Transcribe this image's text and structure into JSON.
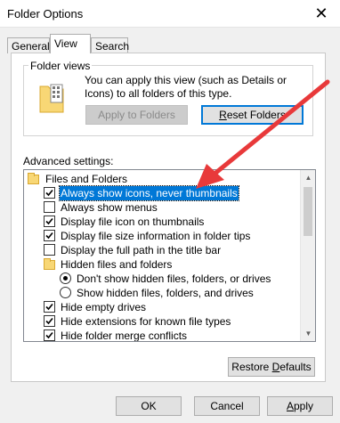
{
  "window": {
    "title": "Folder Options",
    "close_glyph": "✕"
  },
  "tabs": [
    {
      "label": "General"
    },
    {
      "label": "View"
    },
    {
      "label": "Search"
    }
  ],
  "folder_views": {
    "group_label": "Folder views",
    "description": "You can apply this view (such as Details or Icons) to all folders of this type.",
    "apply_button": "Apply to Folders",
    "reset_button_mnemonic": "R",
    "reset_button_rest": "eset Folders"
  },
  "advanced": {
    "label": "Advanced settings:",
    "items": [
      {
        "kind": "folder",
        "label": "Files and Folders"
      },
      {
        "kind": "checkbox",
        "checked": true,
        "selected": true,
        "label": "Always show icons, never thumbnails"
      },
      {
        "kind": "checkbox",
        "checked": false,
        "label": "Always show menus"
      },
      {
        "kind": "checkbox",
        "checked": true,
        "label": "Display file icon on thumbnails"
      },
      {
        "kind": "checkbox",
        "checked": true,
        "label": "Display file size information in folder tips"
      },
      {
        "kind": "checkbox",
        "checked": false,
        "label": "Display the full path in the title bar"
      },
      {
        "kind": "folder",
        "label": "Hidden files and folders"
      },
      {
        "kind": "radio",
        "checked": true,
        "label": "Don't show hidden files, folders, or drives"
      },
      {
        "kind": "radio",
        "checked": false,
        "label": "Show hidden files, folders, and drives"
      },
      {
        "kind": "checkbox",
        "checked": true,
        "label": "Hide empty drives"
      },
      {
        "kind": "checkbox",
        "checked": true,
        "label": "Hide extensions for known file types"
      },
      {
        "kind": "checkbox",
        "checked": true,
        "label": "Hide folder merge conflicts"
      }
    ]
  },
  "restore_button": {
    "prefix": "Restore ",
    "mnemonic": "D",
    "rest": "efaults"
  },
  "footer": {
    "ok": "OK",
    "cancel": "Cancel",
    "apply_mnemonic": "A",
    "apply_rest": "pply"
  },
  "colors": {
    "accent": "#0078d7",
    "annotation_arrow": "#e8393a"
  }
}
